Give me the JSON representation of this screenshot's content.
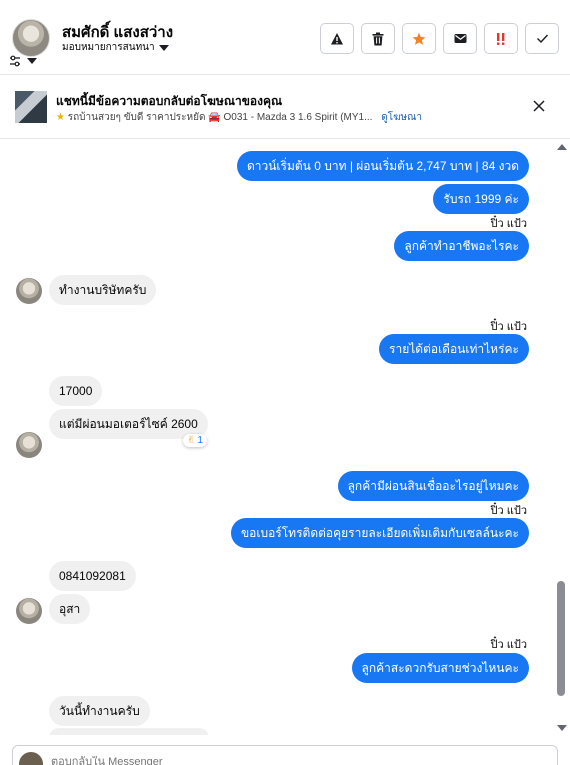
{
  "header": {
    "name": "สมศักดิ์ แสงสว่าง",
    "assign_label": "มอบหมายการสนทนา",
    "actions": [
      {
        "icon": "warning-icon",
        "color": "#1c1e21"
      },
      {
        "icon": "trash-icon",
        "color": "#1c1e21"
      },
      {
        "icon": "star-icon",
        "color": "#f5821f"
      },
      {
        "icon": "mail-icon",
        "color": "#1c1e21"
      },
      {
        "icon": "priority-icon",
        "color": "#e4362b"
      },
      {
        "icon": "check-icon",
        "color": "#1c1e21"
      }
    ]
  },
  "ad": {
    "title": "แชทนี้มีข้อความตอบกลับต่อโฆษณาของคุณ",
    "line": "รถบ้านสวยๆ ขับดี ราคาประหยัด",
    "car_text": "O031 - Mazda 3 1.6 Spirit (MY1...",
    "link": "ดูโฆษณา"
  },
  "messages": [
    {
      "id": "m1",
      "dir": "out",
      "text": "ดาวน์เริ่มต้น 0 บาท | ผ่อนเริ่มต้น 2,747 บาท | 84 งวด"
    },
    {
      "id": "m2",
      "dir": "out",
      "text": "รับรถ 1999 ค่ะ"
    },
    {
      "id": "s1",
      "dir": "sender",
      "text": "ปิ๋ว แป้ว"
    },
    {
      "id": "m3",
      "dir": "out",
      "text": "ลูกค้าทำอาชีพอะไรคะ"
    },
    {
      "id": "m4",
      "dir": "in",
      "text": "ทำงานบริษัทครับ"
    },
    {
      "id": "s2",
      "dir": "sender",
      "text": "ปิ๋ว แป้ว"
    },
    {
      "id": "m5",
      "dir": "out",
      "text": "รายได้ต่อเดือนเท่าไหร่คะ"
    },
    {
      "id": "m6",
      "dir": "in",
      "text": "17000"
    },
    {
      "id": "m7",
      "dir": "in",
      "text": "แต่มีผ่อนมอเตอร์ไซค์ 2600",
      "reaction_count": "1"
    },
    {
      "id": "m8",
      "dir": "out",
      "text": "ลูกค้ามีผ่อนสินเชื่ออะไรอยู่ไหมคะ"
    },
    {
      "id": "s3",
      "dir": "sender",
      "text": "ปิ๋ว แป้ว"
    },
    {
      "id": "m9",
      "dir": "out",
      "text": "ขอเบอร์โทรติดต่อคุยรายละเอียดเพิ่มเติมกับเซลล์นะคะ"
    },
    {
      "id": "m10",
      "dir": "in",
      "text": "0841092081"
    },
    {
      "id": "m11",
      "dir": "in",
      "text": "อุสา"
    },
    {
      "id": "s4",
      "dir": "sender",
      "text": "ปิ๋ว แป้ว"
    },
    {
      "id": "m12",
      "dir": "out",
      "text": "ลูกค้าสะดวกรับสายช่วงไหนคะ"
    },
    {
      "id": "m13",
      "dir": "in",
      "text": "วันนี้ทำงานครับ"
    }
  ],
  "composer": {
    "placeholder": "ตอบกลับใน Messenger"
  },
  "colors": {
    "outgoing": "#1877f2",
    "incoming": "#f0f0f0",
    "link": "#1c5fb8"
  }
}
